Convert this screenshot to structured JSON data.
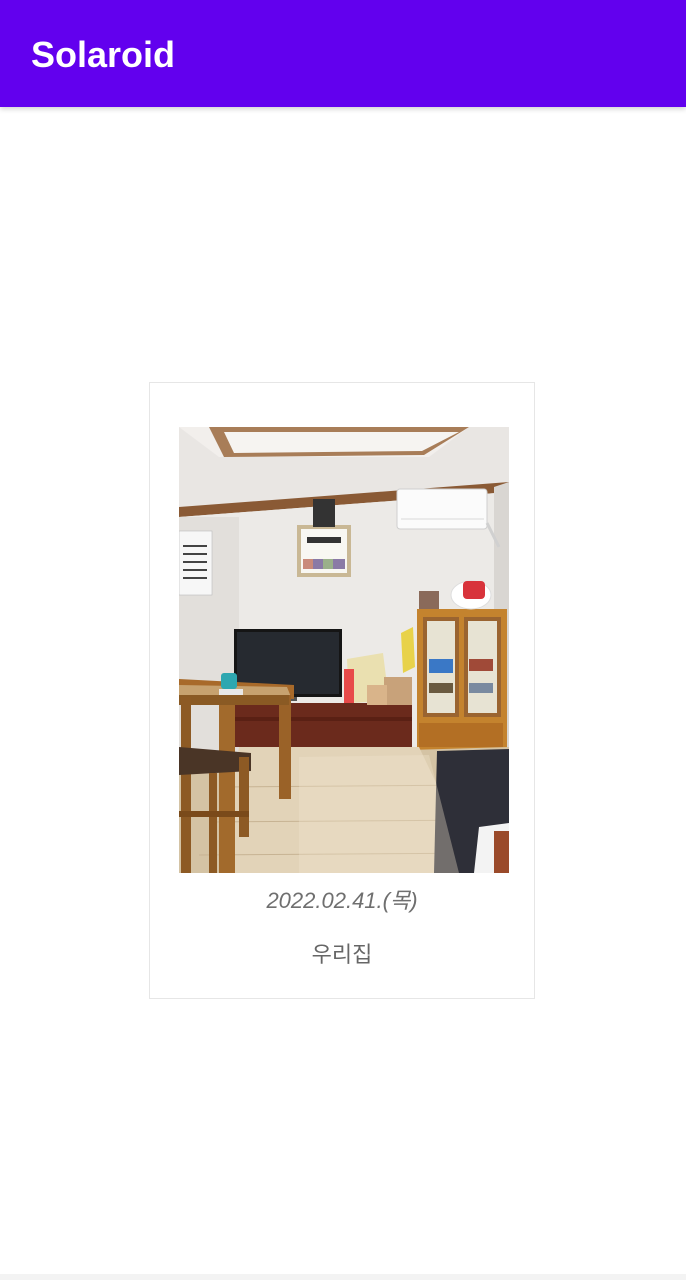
{
  "app": {
    "title": "Solaroid"
  },
  "card": {
    "date": "2022.02.41.(목)",
    "caption": "우리집"
  },
  "colors": {
    "primary": "#6200ee"
  }
}
